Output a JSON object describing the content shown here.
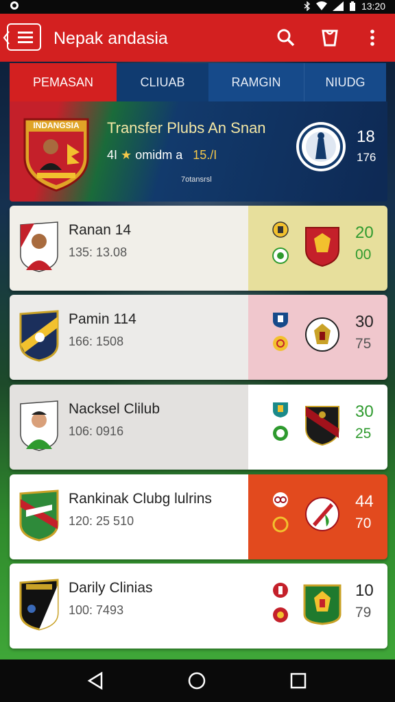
{
  "status_bar": {
    "time": "13:20"
  },
  "app": {
    "title": "Nepak andasia"
  },
  "tabs": [
    {
      "label": "PEMASAN",
      "active": true
    },
    {
      "label": "CLIUAB",
      "active": false
    },
    {
      "label": "RAMGIN",
      "active": false
    },
    {
      "label": "NIUDG",
      "active": false
    }
  ],
  "hero": {
    "crest_text": "INDANGSIA",
    "title": "Transfer Plubs An Snan",
    "sub_left": "4I",
    "sub_mid": "omidm a",
    "sub_value": "15./I",
    "tiny": "7otansrsl",
    "stat_top": "18",
    "stat_bottom": "176"
  },
  "cards": [
    {
      "name": "Ranan 14",
      "sub": "135: 13.08",
      "stat_top": "20",
      "stat_bottom": "00",
      "stat_top_color": "#2e9a2e",
      "stat_bottom_color": "#2e9a2e",
      "left_bg": "#f1efe9",
      "right_bg": "#e7df9c"
    },
    {
      "name": "Pamin 114",
      "sub": "166: 1508",
      "stat_top": "30",
      "stat_bottom": "75",
      "stat_top_color": "#222222",
      "stat_bottom_color": "#555555",
      "left_bg": "#ecebe9",
      "right_bg": "#f0c7cd"
    },
    {
      "name": "Nacksel Clilub",
      "sub": "106: 0916",
      "stat_top": "30",
      "stat_bottom": "25",
      "stat_top_color": "#2e9a2e",
      "stat_bottom_color": "#2e9a2e",
      "left_bg": "#e3e1df",
      "right_bg": "#ffffff"
    },
    {
      "name": "Rankinak Clubg lulrins",
      "sub": "120: 25 510",
      "stat_top": "44",
      "stat_bottom": "70",
      "stat_top_color": "#ffffff",
      "stat_bottom_color": "#ffffff",
      "left_bg": "#ffffff",
      "right_bg": "#e24a1e"
    },
    {
      "name": "Darily Clinias",
      "sub": "100: 7493",
      "stat_top": "10",
      "stat_bottom": "79",
      "stat_top_color": "#222222",
      "stat_bottom_color": "#555555",
      "left_bg": "#ffffff",
      "right_bg": "#ffffff"
    }
  ],
  "icons": [
    "back-arrow-icon",
    "menu-icon",
    "search-icon",
    "bag-icon",
    "more-vert-icon",
    "triangle-back-icon",
    "home-circle-icon",
    "recents-square-icon"
  ],
  "colors": {
    "accent": "#d32020",
    "tab_blue": "#164a8a",
    "tab_active": "#d32020"
  }
}
